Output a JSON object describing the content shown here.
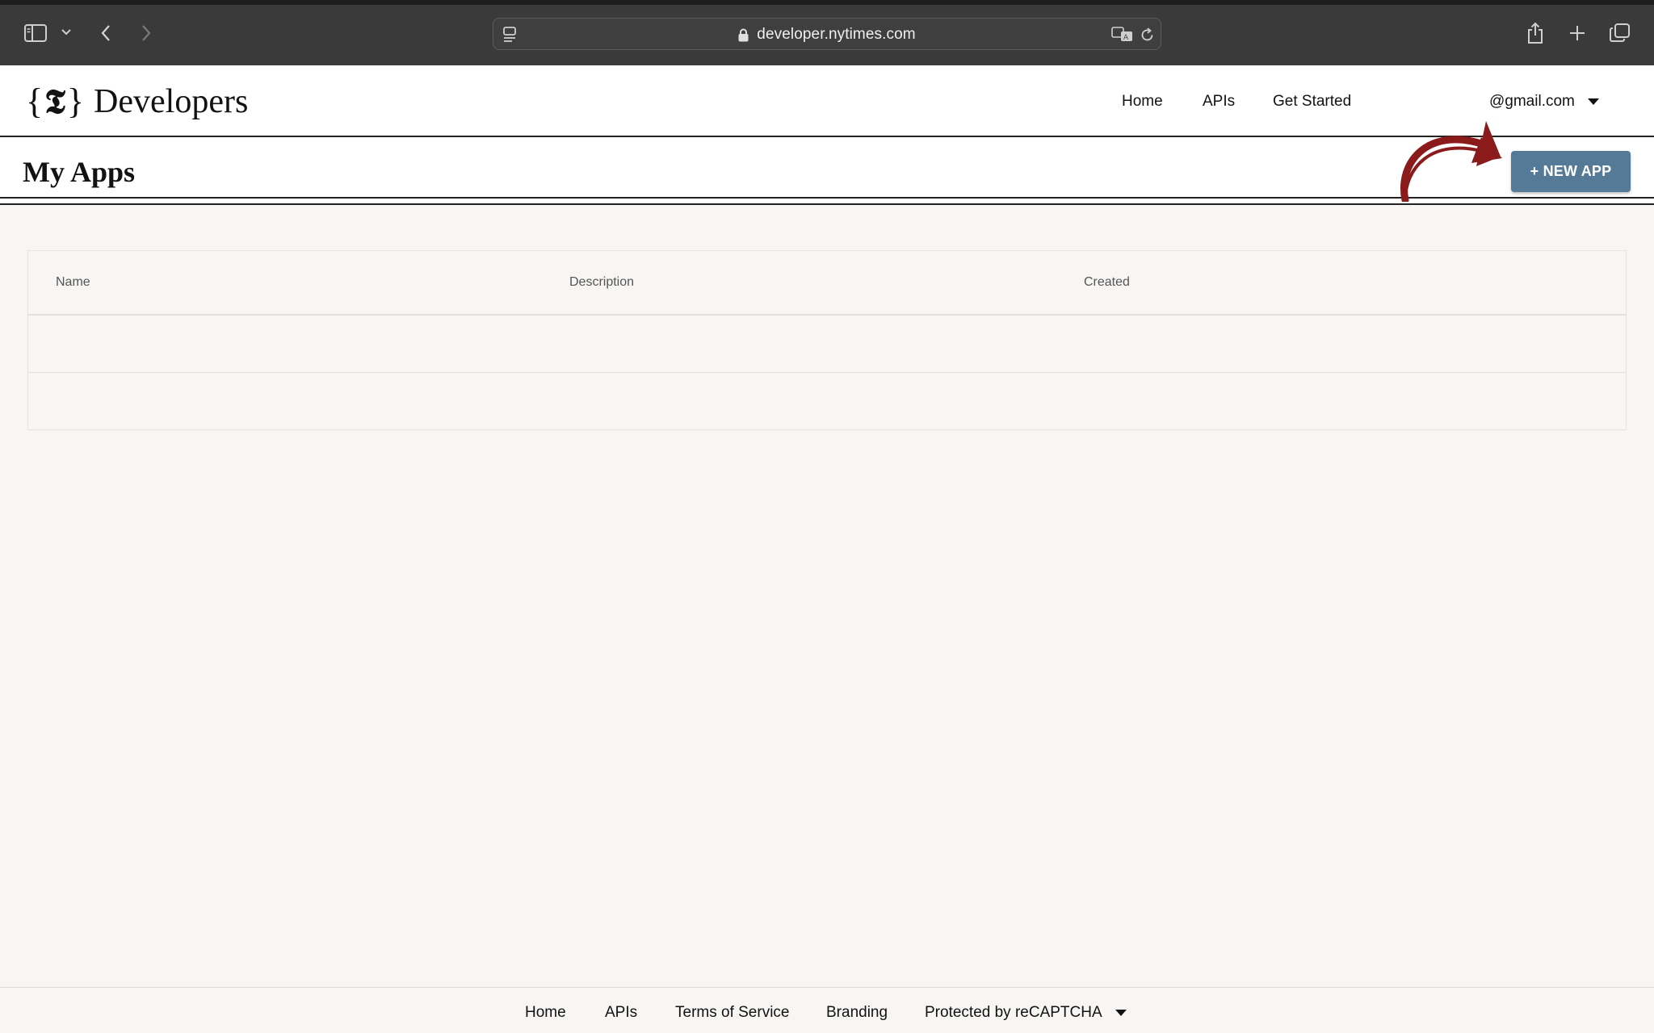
{
  "browser": {
    "url": "developer.nytimes.com"
  },
  "header": {
    "logo_text": "Developers",
    "nav": [
      {
        "label": "Home"
      },
      {
        "label": "APIs"
      },
      {
        "label": "Get Started"
      }
    ],
    "account": "@gmail.com"
  },
  "page": {
    "title": "My Apps",
    "new_app_label": "+ NEW APP"
  },
  "table": {
    "columns": [
      "Name",
      "Description",
      "Created"
    ],
    "rows": []
  },
  "footer": {
    "links": [
      {
        "label": "Home"
      },
      {
        "label": "APIs"
      },
      {
        "label": "Terms of Service"
      },
      {
        "label": "Branding"
      }
    ],
    "recaptcha": "Protected by reCAPTCHA"
  },
  "colors": {
    "chrome": "#3a3a3a",
    "button": "#557a98",
    "arrow": "#8b1a1a",
    "background": "#f7f6f4"
  }
}
